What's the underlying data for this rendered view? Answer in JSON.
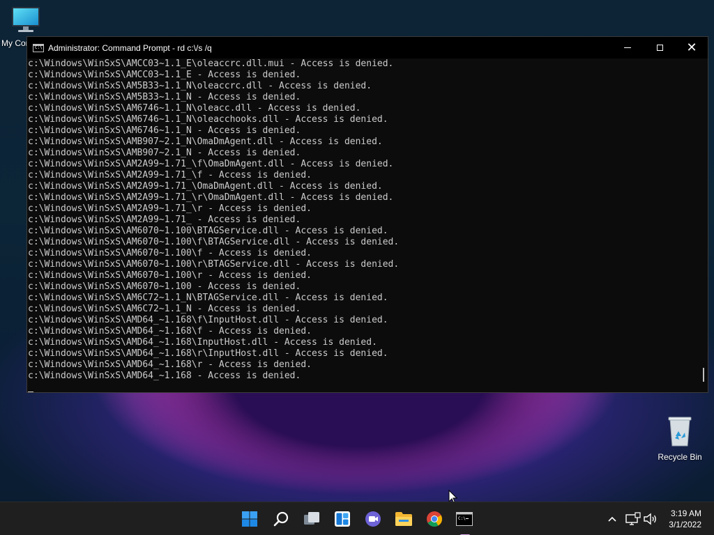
{
  "desktop": {
    "icons": [
      {
        "label": "My Computer",
        "icon": "computer-icon"
      },
      {
        "label": "Recycle Bin",
        "icon": "recycle-bin-icon"
      }
    ]
  },
  "window": {
    "title": "Administrator: Command Prompt - rd  c:\\/s /q",
    "controls": {
      "minimize": "minimize-icon",
      "maximize": "maximize-icon",
      "close": "close-icon"
    },
    "background": "#0c0c0c",
    "text_color": "#cccccc",
    "lines": [
      "c:\\Windows\\WinSxS\\AMCC03~1.1_E\\oleaccrc.dll.mui - Access is denied.",
      "c:\\Windows\\WinSxS\\AMCC03~1.1_E - Access is denied.",
      "c:\\Windows\\WinSxS\\AM5B33~1.1_N\\oleaccrc.dll - Access is denied.",
      "c:\\Windows\\WinSxS\\AM5B33~1.1_N - Access is denied.",
      "c:\\Windows\\WinSxS\\AM6746~1.1_N\\oleacc.dll - Access is denied.",
      "c:\\Windows\\WinSxS\\AM6746~1.1_N\\oleacchooks.dll - Access is denied.",
      "c:\\Windows\\WinSxS\\AM6746~1.1_N - Access is denied.",
      "c:\\Windows\\WinSxS\\AMB907~2.1_N\\OmaDmAgent.dll - Access is denied.",
      "c:\\Windows\\WinSxS\\AMB907~2.1_N - Access is denied.",
      "c:\\Windows\\WinSxS\\AM2A99~1.71_\\f\\OmaDmAgent.dll - Access is denied.",
      "c:\\Windows\\WinSxS\\AM2A99~1.71_\\f - Access is denied.",
      "c:\\Windows\\WinSxS\\AM2A99~1.71_\\OmaDmAgent.dll - Access is denied.",
      "c:\\Windows\\WinSxS\\AM2A99~1.71_\\r\\OmaDmAgent.dll - Access is denied.",
      "c:\\Windows\\WinSxS\\AM2A99~1.71_\\r - Access is denied.",
      "c:\\Windows\\WinSxS\\AM2A99~1.71_ - Access is denied.",
      "c:\\Windows\\WinSxS\\AM6070~1.100\\BTAGService.dll - Access is denied.",
      "c:\\Windows\\WinSxS\\AM6070~1.100\\f\\BTAGService.dll - Access is denied.",
      "c:\\Windows\\WinSxS\\AM6070~1.100\\f - Access is denied.",
      "c:\\Windows\\WinSxS\\AM6070~1.100\\r\\BTAGService.dll - Access is denied.",
      "c:\\Windows\\WinSxS\\AM6070~1.100\\r - Access is denied.",
      "c:\\Windows\\WinSxS\\AM6070~1.100 - Access is denied.",
      "c:\\Windows\\WinSxS\\AM6C72~1.1_N\\BTAGService.dll - Access is denied.",
      "c:\\Windows\\WinSxS\\AM6C72~1.1_N - Access is denied.",
      "c:\\Windows\\WinSxS\\AMD64_~1.168\\f\\InputHost.dll - Access is denied.",
      "c:\\Windows\\WinSxS\\AMD64_~1.168\\f - Access is denied.",
      "c:\\Windows\\WinSxS\\AMD64_~1.168\\InputHost.dll - Access is denied.",
      "c:\\Windows\\WinSxS\\AMD64_~1.168\\r\\InputHost.dll - Access is denied.",
      "c:\\Windows\\WinSxS\\AMD64_~1.168\\r - Access is denied.",
      "c:\\Windows\\WinSxS\\AMD64_~1.168 - Access is denied."
    ]
  },
  "taskbar": {
    "apps": [
      {
        "name": "start",
        "icon": "windows-start-icon"
      },
      {
        "name": "search",
        "icon": "search-icon"
      },
      {
        "name": "task-view",
        "icon": "task-view-icon"
      },
      {
        "name": "widgets",
        "icon": "widgets-icon"
      },
      {
        "name": "chat",
        "icon": "teams-chat-icon"
      },
      {
        "name": "file-explorer",
        "icon": "folder-icon"
      },
      {
        "name": "chrome",
        "icon": "chrome-icon"
      },
      {
        "name": "command-prompt",
        "icon": "terminal-icon",
        "active": true
      }
    ],
    "tray_icons": [
      "chevron-up-icon",
      "network-icon",
      "volume-icon"
    ],
    "time": "3:19 AM",
    "date": "3/1/2022",
    "background": "#1f1f1f"
  }
}
